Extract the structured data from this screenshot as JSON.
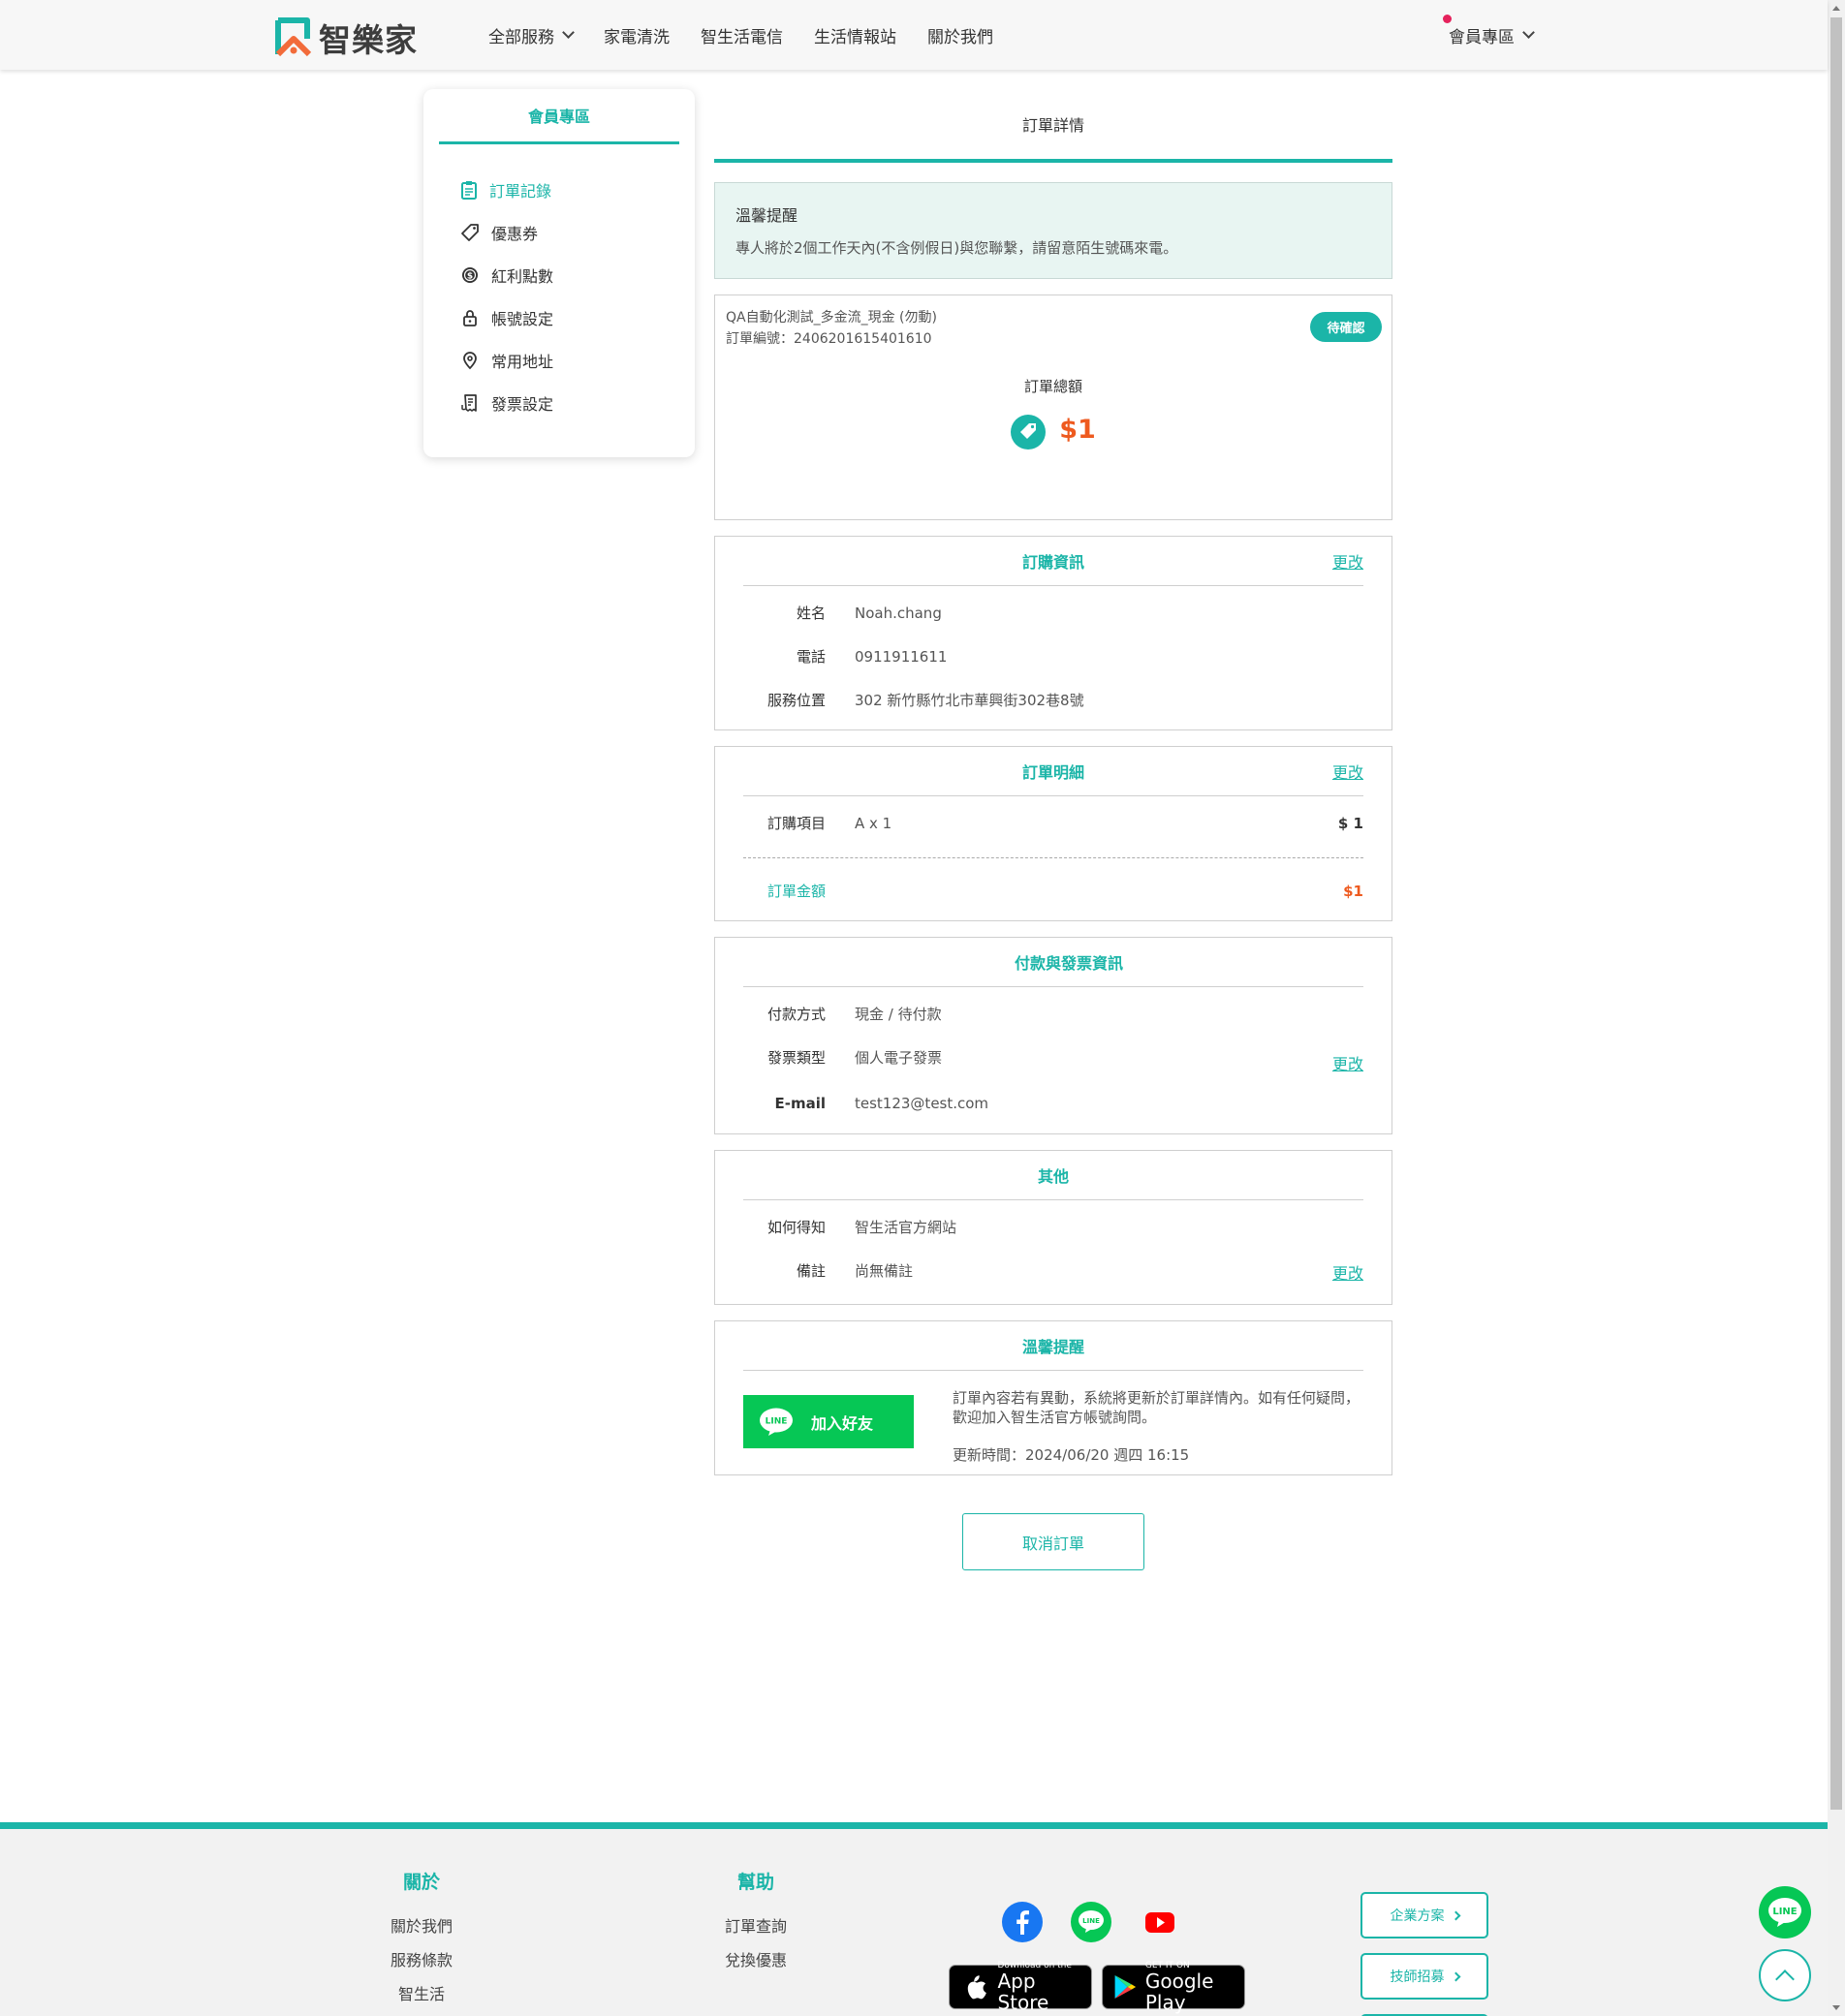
{
  "header": {
    "logo_text": "智樂家",
    "nav": [
      {
        "label": "全部服務",
        "has_dropdown": true
      },
      {
        "label": "家電清洗"
      },
      {
        "label": "智生活電信"
      },
      {
        "label": "生活情報站"
      },
      {
        "label": "關於我們"
      }
    ],
    "member_menu": "會員專區"
  },
  "sidebar": {
    "title": "會員專區",
    "items": [
      {
        "label": "訂單記錄",
        "icon": "clipboard-icon",
        "active": true
      },
      {
        "label": "優惠券",
        "icon": "tag-icon"
      },
      {
        "label": "紅利點數",
        "icon": "coin-icon"
      },
      {
        "label": "帳號設定",
        "icon": "lock-icon"
      },
      {
        "label": "常用地址",
        "icon": "location-pin-icon"
      },
      {
        "label": "發票設定",
        "icon": "receipt-icon"
      }
    ]
  },
  "main": {
    "page_title": "訂單詳情",
    "notice": {
      "title": "溫馨提醒",
      "text": "專人將於2個工作天內(不含例假日)與您聯繫，請留意陌生號碼來電。"
    },
    "order": {
      "name": "QA自動化測試_多金流_現金 (勿動)",
      "number": "訂單編號：2406201615401610",
      "status": "待確認",
      "total_label": "訂單總額",
      "total_amount": "$1"
    },
    "purchase_info": {
      "title": "訂購資訊",
      "edit": "更改",
      "rows": [
        {
          "label": "姓名",
          "value": "Noah.chang"
        },
        {
          "label": "電話",
          "value": "0911911611"
        },
        {
          "label": "服務位置",
          "value": "302 新竹縣竹北市華興街302巷8號"
        }
      ]
    },
    "order_detail": {
      "title": "訂單明細",
      "edit": "更改",
      "item_label": "訂購項目",
      "item_value": "A x 1",
      "item_price": "$ 1",
      "amount_label": "訂單金額",
      "amount_value": "$1"
    },
    "payment": {
      "title": "付款與發票資訊",
      "edit": "更改",
      "rows": [
        {
          "label": "付款方式",
          "value": "現金 / 待付款"
        },
        {
          "label": "發票類型",
          "value": "個人電子發票"
        },
        {
          "label": "E-mail",
          "value": "test123@test.com"
        }
      ]
    },
    "other": {
      "title": "其他",
      "edit": "更改",
      "rows": [
        {
          "label": "如何得知",
          "value": "智生活官方網站"
        },
        {
          "label": "備註",
          "value": "尚無備註"
        }
      ]
    },
    "reminder": {
      "title": "溫馨提醒",
      "line_badge": "LINE",
      "line_button": "加入好友",
      "text": "訂單內容若有異動，系統將更新於訂單詳情內。如有任何疑問，歡迎加入智生活官方帳號詢問。",
      "updated": "更新時間：2024/06/20 週四 16:15"
    },
    "cancel_button": "取消訂單"
  },
  "footer": {
    "about": {
      "title": "關於",
      "links": [
        "關於我們",
        "服務條款",
        "智生活"
      ]
    },
    "help": {
      "title": "幫助",
      "links": [
        "訂單查詢",
        "兌換優惠"
      ]
    },
    "socials": [
      "facebook-icon",
      "line-icon",
      "youtube-icon"
    ],
    "line_logo_text": "LINE",
    "app_store": {
      "small": "Download on the",
      "big": "App Store"
    },
    "google_play": {
      "small": "GET IT ON",
      "big": "Google Play"
    },
    "buttons": [
      "企業方案",
      "技師招募"
    ]
  },
  "colors": {
    "accent": "#1bb5a8",
    "price": "#ee5a1f",
    "line_green": "#06c755",
    "notice_bg": "#e8f5f2"
  }
}
